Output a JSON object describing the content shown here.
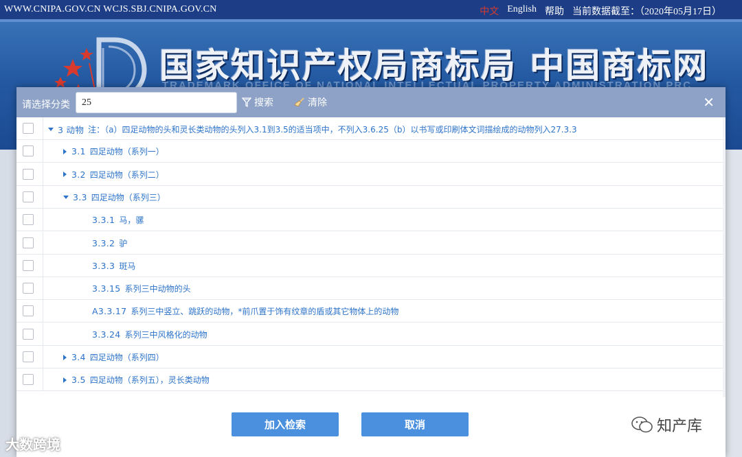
{
  "site": {
    "top_url": "WWW.CNIPA.GOV.CN WCJS.SBJ.CNIPA.GOV.CN",
    "lang_cn": "中文",
    "lang_en": "English",
    "help": "帮助",
    "data_date": "当前数据截至：（2020年05月17日）",
    "banner_title": "国家知识产权局商标局 中国商标网",
    "banner_subtitle": "TRADEMARK OFFICE OF NATIONAL INTELLECTUAL PROPERTY ADMINISTRATION PRC"
  },
  "dialog": {
    "select_label": "请选择分类",
    "search_value": "25",
    "search_button": "搜索",
    "clear_button": "清除",
    "close_icon": "close-icon",
    "rows": [
      {
        "level": 0,
        "arrow": "down",
        "code": "3 动物",
        "desc": "注：（a）四足动物的头和灵长类动物的头列入3.1到3.5的适当项中，不列入3.6.25（b）以书写或印刷体文词描绘成的动物列入27.3.3"
      },
      {
        "level": 1,
        "arrow": "right",
        "code": "3.1",
        "desc": "四足动物（系列一）"
      },
      {
        "level": 1,
        "arrow": "right",
        "code": "3.2",
        "desc": "四足动物（系列二）"
      },
      {
        "level": 1,
        "arrow": "down",
        "code": "3.3",
        "desc": "四足动物（系列三）"
      },
      {
        "level": 2,
        "arrow": "",
        "code": "3.3.1",
        "desc": "马，骡"
      },
      {
        "level": 2,
        "arrow": "",
        "code": "3.3.2",
        "desc": "驴"
      },
      {
        "level": 2,
        "arrow": "",
        "code": "3.3.3",
        "desc": "斑马"
      },
      {
        "level": 2,
        "arrow": "",
        "code": "3.3.15",
        "desc": "系列三中动物的头"
      },
      {
        "level": 2,
        "arrow": "",
        "code": "A3.3.17",
        "desc": "系列三中竖立、跳跃的动物，*前爪置于饰有纹章的盾或其它物体上的动物"
      },
      {
        "level": 2,
        "arrow": "",
        "code": "3.3.24",
        "desc": "系列三中风格化的动物"
      },
      {
        "level": 1,
        "arrow": "right",
        "code": "3.4",
        "desc": "四足动物（系列四）"
      },
      {
        "level": 1,
        "arrow": "right",
        "code": "3.5",
        "desc": "四足动物（系列五），灵长类动物"
      }
    ],
    "add_button": "加入检索",
    "cancel_button": "取消"
  },
  "watermarks": {
    "left": "大数跨境",
    "right": "知产库"
  },
  "colors": {
    "topbar": "#1d3e86",
    "dialog_header": "#8da2c6",
    "link_blue": "#2c73c9",
    "button_blue": "#4a90de"
  }
}
